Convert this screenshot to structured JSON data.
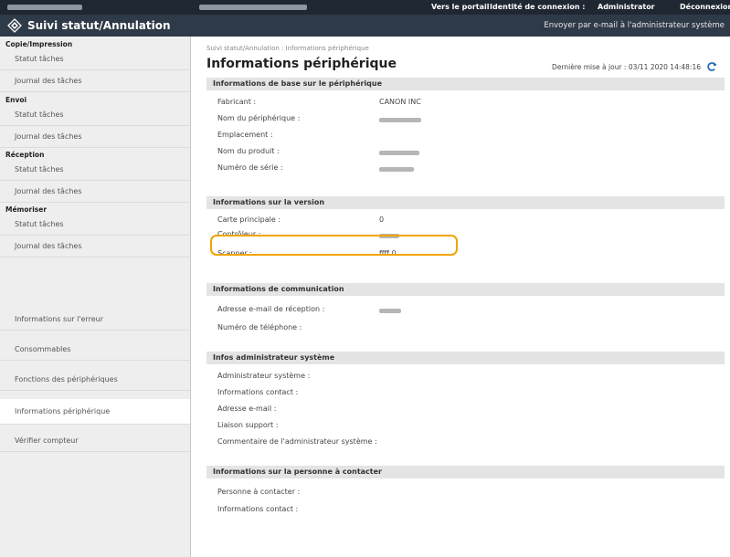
{
  "topbar": {
    "portal_label": "Vers le portail",
    "login_id_label": "Identité de connexion :",
    "login_user": "Administrator",
    "logout_label": "Déconnexion"
  },
  "header": {
    "title": "Suivi statut/Annulation",
    "mail_admin_link": "Envoyer par e-mail à l'administrateur système"
  },
  "sidebar": {
    "groups": [
      {
        "heading": "Copie/Impression",
        "items": [
          "Statut tâches",
          "Journal des tâches"
        ]
      },
      {
        "heading": "Envoi",
        "items": [
          "Statut tâches",
          "Journal des tâches"
        ]
      },
      {
        "heading": "Réception",
        "items": [
          "Statut tâches",
          "Journal des tâches"
        ]
      },
      {
        "heading": "Mémoriser",
        "items": [
          "Statut tâches",
          "Journal des tâches"
        ]
      }
    ],
    "items": [
      "Informations sur l'erreur",
      "Consommables",
      "Fonctions des périphériques",
      "Informations périphérique",
      "Vérifier compteur"
    ],
    "selected_item": "Informations périphérique"
  },
  "main": {
    "breadcrumb": "Suivi statut/Annulation : Informations périphérique",
    "title": "Informations périphérique",
    "updated_label": "Dernière mise à jour : 03/11 2020 14:48:16",
    "sections": [
      {
        "title": "Informations de base sur le périphérique",
        "rows": [
          {
            "label": "Fabricant :",
            "value": "CANON INC"
          },
          {
            "label": "Nom du périphérique :",
            "value": ""
          },
          {
            "label": "Emplacement :",
            "value": ""
          },
          {
            "label": "Nom du produit :",
            "value": ""
          },
          {
            "label": "Numéro de série :",
            "value": ""
          }
        ]
      },
      {
        "title": "Informations sur la version",
        "rows": [
          {
            "label": "Carte principale :",
            "value": "0"
          },
          {
            "label": "Contrôleur :",
            "value": ""
          },
          {
            "label": "Scanner :",
            "value": "ffff.0"
          }
        ]
      },
      {
        "title": "Informations de communication",
        "rows": [
          {
            "label": "Adresse e-mail de réception :",
            "value": ""
          },
          {
            "label": "Numéro de téléphone :",
            "value": ""
          }
        ]
      },
      {
        "title": "Infos administrateur système",
        "rows": [
          {
            "label": "Administrateur système :",
            "value": ""
          },
          {
            "label": "Informations contact :",
            "value": ""
          },
          {
            "label": "Adresse e-mail :",
            "value": ""
          },
          {
            "label": "Liaison support :",
            "value": ""
          },
          {
            "label": "Commentaire de l'administrateur système :",
            "value": ""
          }
        ]
      },
      {
        "title": "Informations sur la personne à contacter",
        "rows": [
          {
            "label": "Personne à contacter :",
            "value": ""
          },
          {
            "label": "Informations contact :",
            "value": ""
          }
        ]
      }
    ]
  },
  "colors": {
    "topbar": "#1f2733",
    "header": "#2f3a48",
    "highlight": "#f0a400",
    "sidebar": "#eeeeee",
    "section": "#e4e4e4"
  },
  "icons": [
    "canon-device-logo-icon",
    "refresh-icon"
  ]
}
